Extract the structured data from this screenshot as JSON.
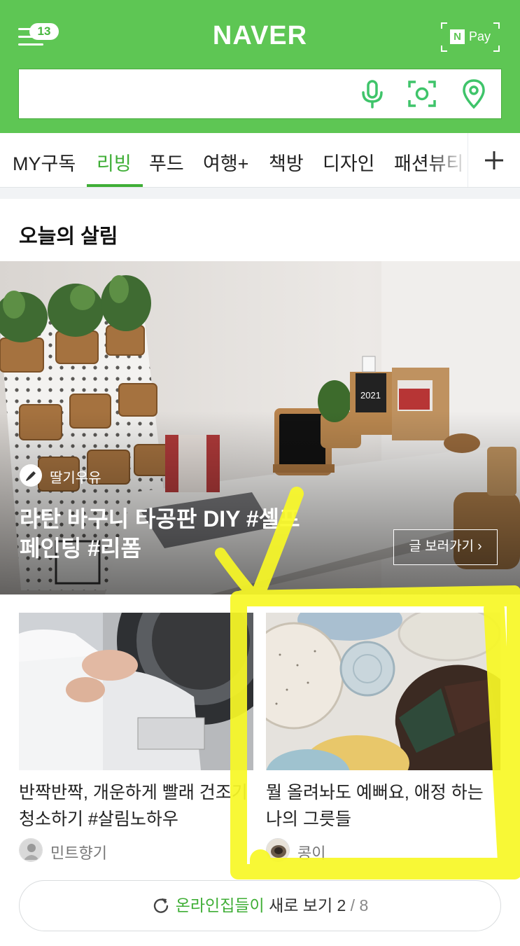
{
  "header": {
    "menu_badge": "13",
    "logo": "NAVER",
    "npay_n": "N",
    "npay_label": "Pay"
  },
  "search": {
    "value": "",
    "placeholder": ""
  },
  "tabs": [
    {
      "label": "MY구독"
    },
    {
      "label": "리빙"
    },
    {
      "label": "푸드"
    },
    {
      "label": "여행+"
    },
    {
      "label": "책방"
    },
    {
      "label": "디자인"
    },
    {
      "label": "패션뷰티"
    }
  ],
  "section": {
    "title": "오늘의 살림"
  },
  "hero": {
    "author": "딸기우유",
    "title": "라탄 바구니 타공판 DIY #셀프페인팅 #리폼",
    "button": "글 보러가기 ›",
    "calendar_year": "2021"
  },
  "cards": [
    {
      "title": "반짝반짝, 개운하게 빨래 건조기 청소하기 #살림노하우",
      "author": "민트향기"
    },
    {
      "title": "뭘 올려놔도 예뻐요, 애정 하는 나의 그릇들",
      "author": "콩이"
    }
  ],
  "more": {
    "highlight": "온라인집들이",
    "text": " 새로 보기 ",
    "current": "2",
    "separator": " / ",
    "total": "8"
  },
  "colors": {
    "naver_green": "#5ec654",
    "accent_green": "#3fae36",
    "highlighter": "#f8f826"
  }
}
